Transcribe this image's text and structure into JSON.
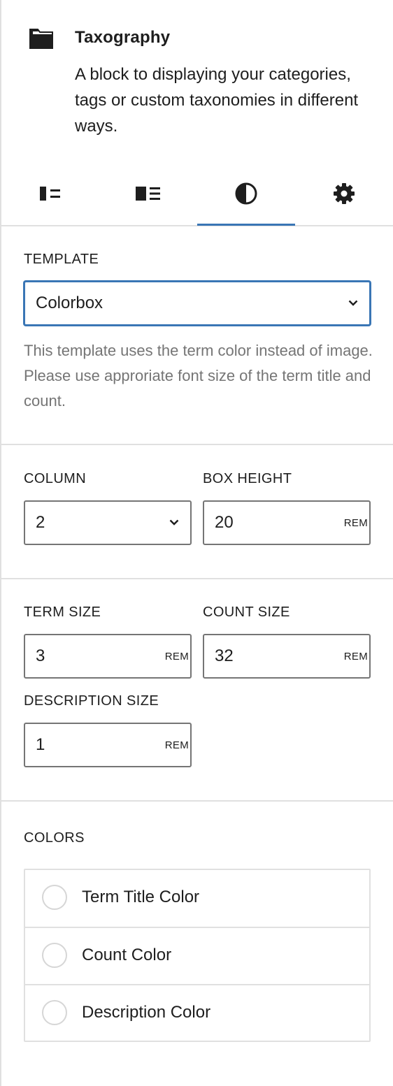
{
  "block": {
    "icon": "folder-icon",
    "title": "Taxography",
    "description": "A block to displaying your categories, tags or custom taxonomies in different ways."
  },
  "tabs": [
    {
      "icon": "list-layout-icon",
      "active": false
    },
    {
      "icon": "block-list-icon",
      "active": false
    },
    {
      "icon": "contrast-icon",
      "active": true
    },
    {
      "icon": "gear-icon",
      "active": false
    }
  ],
  "template": {
    "label": "TEMPLATE",
    "value": "Colorbox",
    "help": "This template uses the term color instead of image. Please use approriate font size of the term title and count."
  },
  "layout": {
    "column_label": "COLUMN",
    "column_value": "2",
    "box_height_label": "BOX HEIGHT",
    "box_height_value": "20",
    "box_height_unit": "REM"
  },
  "sizes": {
    "term_label": "TERM SIZE",
    "term_value": "3",
    "term_unit": "REM",
    "count_label": "COUNT SIZE",
    "count_value": "32",
    "count_unit": "REM",
    "description_label": "DESCRIPTION SIZE",
    "description_value": "1",
    "description_unit": "REM"
  },
  "colors": {
    "label": "COLORS",
    "items": [
      {
        "label": "Term Title Color"
      },
      {
        "label": "Count Color"
      },
      {
        "label": "Description Color"
      }
    ]
  },
  "accent_color": "#3a76b5"
}
